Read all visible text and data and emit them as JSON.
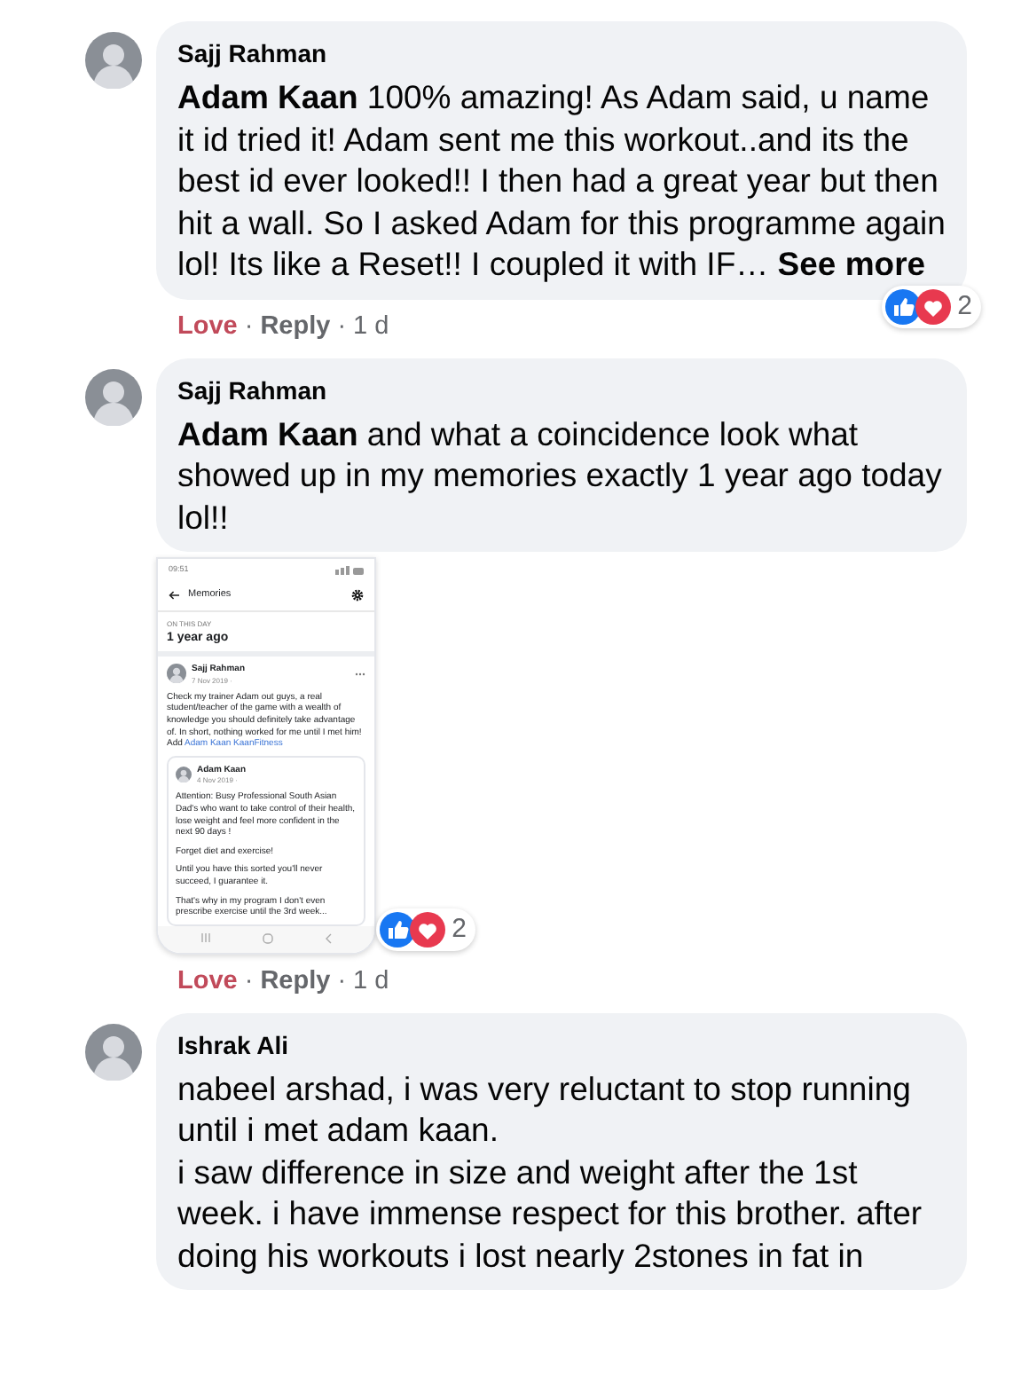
{
  "comments": [
    {
      "author": "Sajj Rahman",
      "text": "**Adam Kaan** 100% amazing! As Adam said, u name it id tried it! Adam sent me this workout..and its the best id ever looked!! I then had a great year but then hit a wall. So I asked Adam for this programme again lol! Its like a Reset!! I coupled it with IF…",
      "see_more": "See more",
      "reactions": {
        "types": [
          {
            "kind": "like"
          },
          {
            "kind": "love"
          }
        ],
        "count": "2"
      },
      "actions": {
        "love": {
          "label": "Love",
          "selected": true
        },
        "separator": "·",
        "reply": "Reply",
        "age": "1 d"
      }
    },
    {
      "author": "Sajj Rahman",
      "text": "**Adam Kaan** and what a coincidence look what showed up in my memories exactly 1 year ago today lol!!",
      "attachment": {
        "kind": "screenshot",
        "status_time": "09:51",
        "header": "Memories",
        "section_label": "ON THIS DAY",
        "section_title": "1 year ago",
        "post": {
          "author": "Sajj Rahman",
          "date": "7 Nov 2019 ·",
          "text": "Check my trainer Adam out guys, a real student/teacher of the game with a wealth of knowledge you should definitely take advantage of. In short, nothing worked for me until I met him! Add",
          "links": [
            "Adam Kaan",
            "KaanFitness"
          ],
          "shared": {
            "author": "Adam Kaan",
            "date": "4 Nov 2019 ·",
            "paragraphs": [
              "Attention: Busy Professional South Asian Dad's who want to take control of their health, lose weight and feel more confident in the next 90 days !",
              "Forget diet and exercise!",
              "Until you have this sorted you'll never succeed, I guarantee it.",
              "That's why in my program I don't even prescribe exercise until the 3rd week..."
            ]
          }
        }
      },
      "reactions": {
        "types": [
          {
            "kind": "like"
          },
          {
            "kind": "love"
          }
        ],
        "count": "2"
      },
      "actions": {
        "love": {
          "label": "Love",
          "selected": true
        },
        "separator": "·",
        "reply": "Reply",
        "age": "1 d"
      }
    },
    {
      "author": "Ishrak Ali",
      "paragraphs": [
        "nabeel arshad, i was very reluctant to stop running until i met adam kaan.",
        "i saw difference in size and weight after the 1st week. i have immense respect for this brother. after doing his workouts i lost nearly 2stones in fat in"
      ]
    }
  ]
}
